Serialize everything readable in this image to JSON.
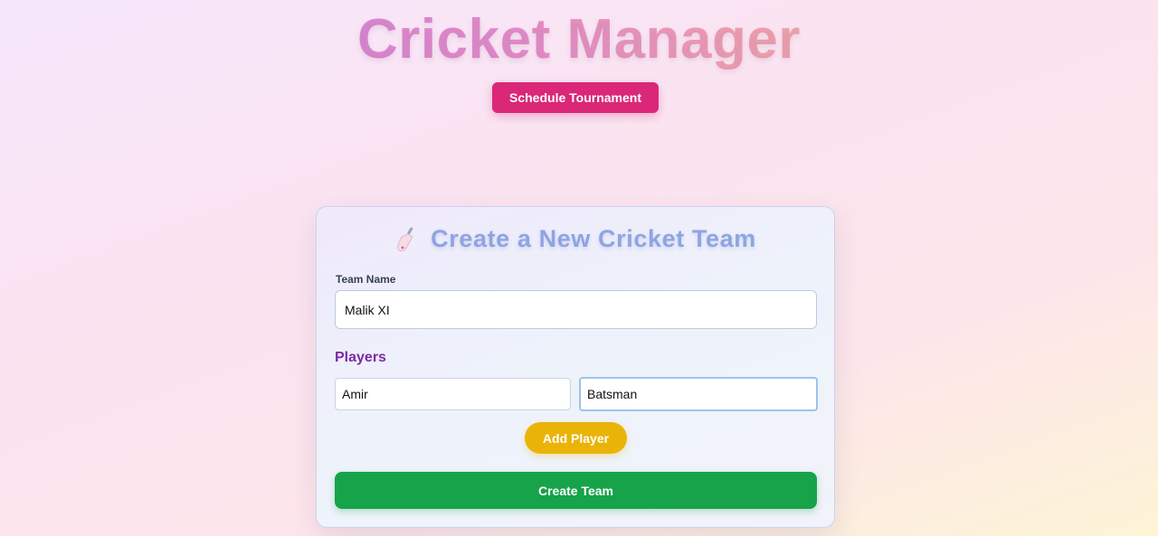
{
  "header": {
    "title": "Cricket Manager",
    "schedule_label": "Schedule Tournament"
  },
  "form": {
    "icon": "cricket-bat-icon",
    "title": "Create a New Cricket Team",
    "team_name_label": "Team Name",
    "team_name_value": "Malik XI",
    "players_heading": "Players",
    "player_name_value": "Amir",
    "player_role_value": "Batsman",
    "add_player_label": "Add Player",
    "create_team_label": "Create Team"
  },
  "colors": {
    "schedule_button": "#db2777",
    "add_player_button": "#eab308",
    "create_team_button": "#16a34a",
    "card_title": "#8ea5e3",
    "players_heading": "#7e2aa3"
  }
}
